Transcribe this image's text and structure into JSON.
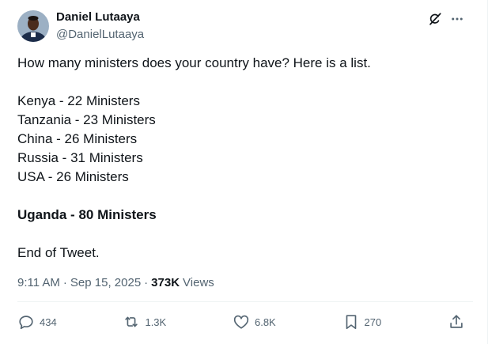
{
  "author": {
    "display_name": "Daniel Lutaaya",
    "handle": "@DanielLutaaya"
  },
  "body": {
    "intro": "How many ministers does your country have? Here is a list.",
    "list": [
      "Kenya - 22 Ministers",
      "Tanzania - 23 Ministers",
      "China - 26 Ministers",
      "Russia - 31 Ministers",
      "USA - 26 Ministers"
    ],
    "highlight": "Uganda - 80 Ministers",
    "closing": "End of Tweet."
  },
  "meta": {
    "time": "9:11 AM",
    "separator": "·",
    "date": "Sep 15, 2025",
    "views_count": "373K",
    "views_label": "Views"
  },
  "actions": {
    "replies": "434",
    "reposts": "1.3K",
    "likes": "6.8K",
    "bookmarks": "270"
  },
  "icons": {
    "grok": "grok-icon",
    "more": "more-icon",
    "reply": "reply-icon",
    "repost": "repost-icon",
    "like": "heart-icon",
    "bookmark": "bookmark-icon",
    "share": "share-icon"
  }
}
